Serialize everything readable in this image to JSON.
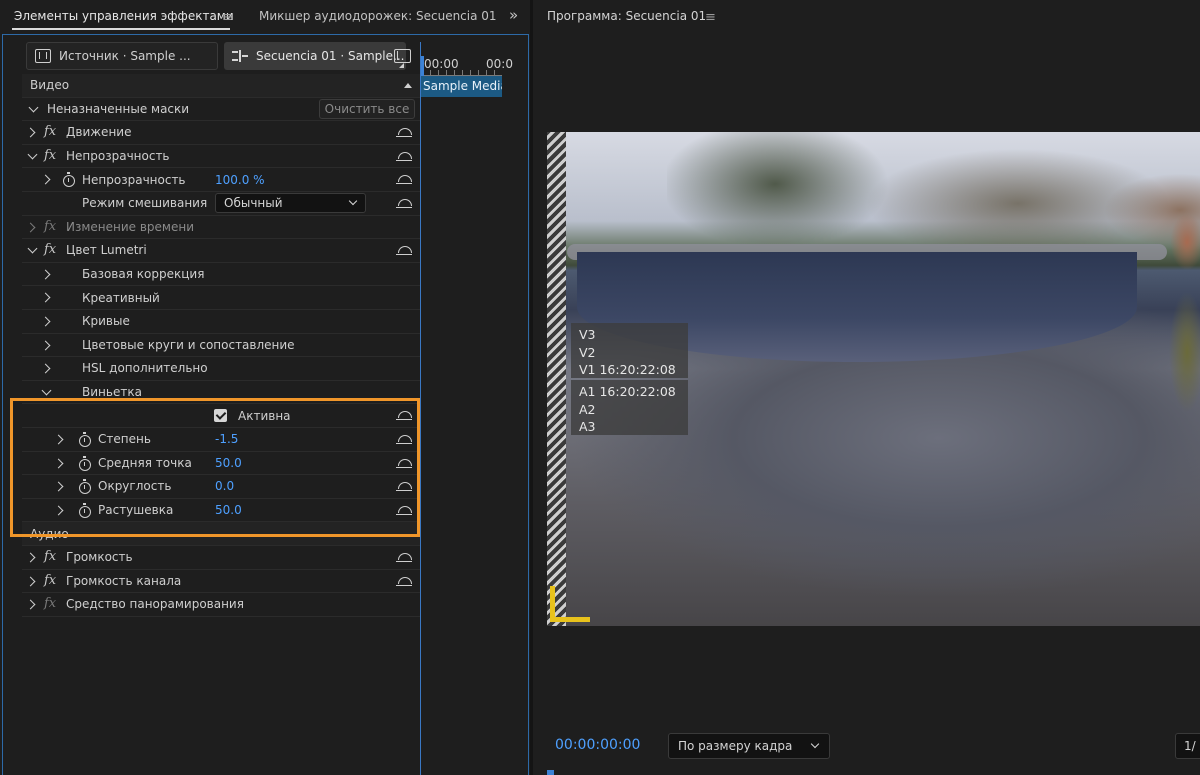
{
  "left_panel": {
    "tabs": {
      "effect_controls": "Элементы управления эффектами",
      "audio_mixer": "Микшер аудиодорожек: Secuencia 01"
    },
    "source_tab": "Источник · Sample ...",
    "sequence_tab": "Secuencia 01 · Sample...",
    "mini_timeline": {
      "time_start": "00:00",
      "time_next": "00:0",
      "clip_name": "Sample Media"
    },
    "video_header": "Видео",
    "unassigned_masks": "Неназначенные маски",
    "clear_all": "Очистить все",
    "motion": "Движение",
    "opacity_group": "Непрозрачность",
    "opacity_label": "Непрозрачность",
    "opacity_value": "100.0 %",
    "blend_mode_label": "Режим смешивания",
    "blend_mode_value": "Обычный",
    "time_remap": "Изменение времени",
    "lumetri": "Цвет Lumetri",
    "lumetri_sections": [
      "Базовая коррекция",
      "Креативный",
      "Кривые",
      "Цветовые круги и сопоставление",
      "HSL дополнительно",
      "Виньетка"
    ],
    "vignette": {
      "active_label": "Активна",
      "active_checked": true,
      "params": [
        {
          "label": "Степень",
          "value": "-1.5"
        },
        {
          "label": "Средняя точка",
          "value": "50.0"
        },
        {
          "label": "Округлость",
          "value": "0.0"
        },
        {
          "label": "Растушевка",
          "value": "50.0"
        }
      ]
    },
    "audio_header": "Аудио",
    "volume": "Громкость",
    "channel_volume": "Громкость канала",
    "panner": "Средство панорамирования"
  },
  "program_monitor": {
    "title": "Программа: Secuencia 01",
    "track_overlay_video": [
      "V3",
      "V2",
      "V1 16:20:22:08"
    ],
    "track_overlay_audio": [
      "A1 16:20:22:08",
      "A2",
      "A3"
    ],
    "timecode": "00:00:00:00",
    "zoom_select": "По размеру кадра",
    "resolution_select": "1/"
  },
  "colors": {
    "accent_blue": "#4ea0ff",
    "highlight_orange": "#f0962a",
    "safe_margin_yellow": "#e8c21c",
    "clip_blue": "#1c5a84"
  }
}
